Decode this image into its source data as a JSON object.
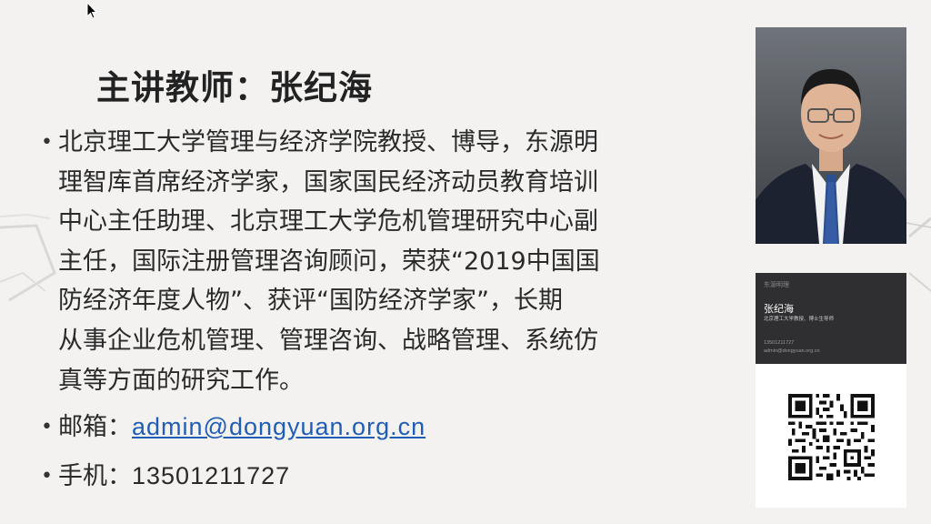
{
  "slide": {
    "title": "主讲教师：张纪海",
    "bullets": {
      "bio_lines": [
        "北京理工大学管理与经济学院教授、博导，东源明",
        "理智库首席经济学家，国家国民经济动员教育培训",
        "中心主任助理、北京理工大学危机管理研究中心副",
        "主任，国际注册管理咨询顾问，荣获“2019中国国",
        "防经济年度人物”、获评“国防经济学家”，长期",
        "从事企业危机管理、管理咨询、战略管理、系统仿",
        "真等方面的研究工作。"
      ],
      "email_label": "邮箱：",
      "email": "admin@dongyuan.org.cn",
      "phone_label": "手机：",
      "phone": "13501211727"
    }
  },
  "card": {
    "brand": "东源明理",
    "name": "张纪海",
    "title": "北京理工大学教授、博士生导师",
    "phone": "13501211727",
    "email": "admin@dongyuan.org.cn"
  },
  "colors": {
    "slide_bg": "#f3f2f0",
    "link": "#1f5db6",
    "card_dark": "#2f2f31"
  }
}
